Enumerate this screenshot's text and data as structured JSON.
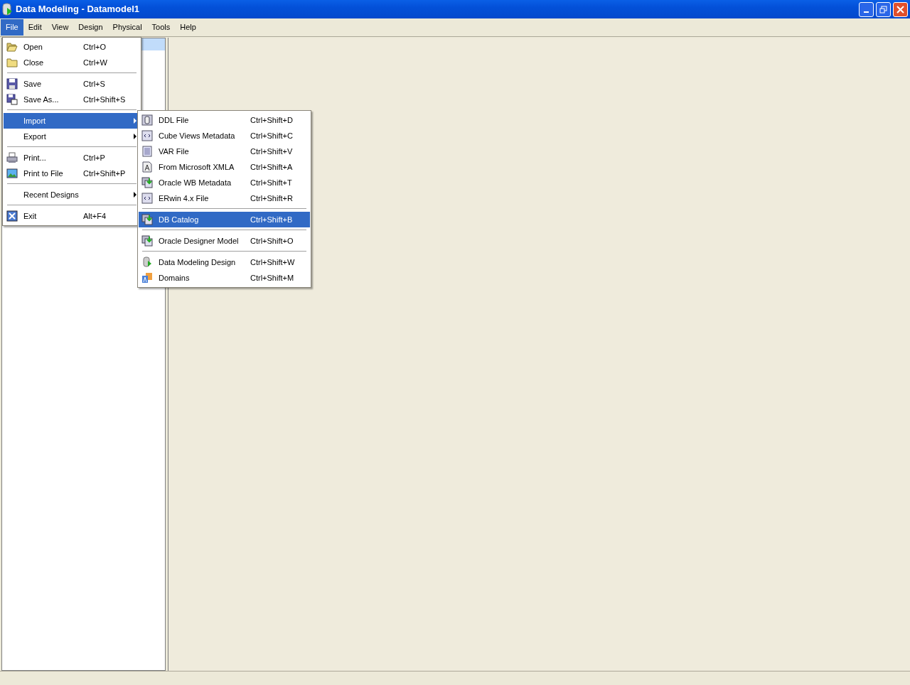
{
  "window": {
    "title": "Data Modeling - Datamodel1"
  },
  "menubar": [
    {
      "label": "File",
      "selected": true
    },
    {
      "label": "Edit",
      "selected": false
    },
    {
      "label": "View",
      "selected": false
    },
    {
      "label": "Design",
      "selected": false
    },
    {
      "label": "Physical",
      "selected": false
    },
    {
      "label": "Tools",
      "selected": false
    },
    {
      "label": "Help",
      "selected": false
    }
  ],
  "file_menu": [
    {
      "kind": "item",
      "label": "Open",
      "shortcut": "Ctrl+O",
      "selected": false,
      "submenu": false
    },
    {
      "kind": "item",
      "label": "Close",
      "shortcut": "Ctrl+W",
      "selected": false,
      "submenu": false
    },
    {
      "kind": "separator"
    },
    {
      "kind": "item",
      "label": "Save",
      "shortcut": "Ctrl+S",
      "selected": false,
      "submenu": false
    },
    {
      "kind": "item",
      "label": "Save As...",
      "shortcut": "Ctrl+Shift+S",
      "selected": false,
      "submenu": false
    },
    {
      "kind": "separator"
    },
    {
      "kind": "item",
      "label": "Import",
      "selected": true,
      "submenu": true
    },
    {
      "kind": "item",
      "label": "Export",
      "selected": false,
      "submenu": true
    },
    {
      "kind": "separator"
    },
    {
      "kind": "item",
      "label": "Print...",
      "shortcut": "Ctrl+P",
      "selected": false,
      "submenu": false
    },
    {
      "kind": "item",
      "label": "Print to File",
      "shortcut": "Ctrl+Shift+P",
      "selected": false,
      "submenu": false
    },
    {
      "kind": "separator"
    },
    {
      "kind": "item",
      "label": "Recent Designs",
      "selected": false,
      "submenu": true
    },
    {
      "kind": "separator"
    },
    {
      "kind": "item",
      "label": "Exit",
      "shortcut": "Alt+F4",
      "selected": false,
      "submenu": false
    }
  ],
  "import_menu": [
    {
      "kind": "item",
      "label": "DDL File",
      "shortcut": "Ctrl+Shift+D",
      "selected": false
    },
    {
      "kind": "item",
      "label": "Cube Views Metadata",
      "shortcut": "Ctrl+Shift+C",
      "selected": false
    },
    {
      "kind": "item",
      "label": "VAR File",
      "shortcut": "Ctrl+Shift+V",
      "selected": false
    },
    {
      "kind": "item",
      "label": "From Microsoft XMLA",
      "shortcut": "Ctrl+Shift+A",
      "selected": false
    },
    {
      "kind": "item",
      "label": "Oracle WB Metadata",
      "shortcut": "Ctrl+Shift+T",
      "selected": false
    },
    {
      "kind": "item",
      "label": "ERwin 4.x File",
      "shortcut": "Ctrl+Shift+R",
      "selected": false
    },
    {
      "kind": "separator"
    },
    {
      "kind": "item",
      "label": "DB Catalog",
      "shortcut": "Ctrl+Shift+B",
      "selected": true
    },
    {
      "kind": "separator"
    },
    {
      "kind": "item",
      "label": "Oracle Designer Model",
      "shortcut": "Ctrl+Shift+O",
      "selected": false
    },
    {
      "kind": "separator"
    },
    {
      "kind": "item",
      "label": "Data Modeling Design",
      "shortcut": "Ctrl+Shift+W",
      "selected": false
    },
    {
      "kind": "item",
      "label": "Domains",
      "shortcut": "Ctrl+Shift+M",
      "selected": false
    }
  ]
}
